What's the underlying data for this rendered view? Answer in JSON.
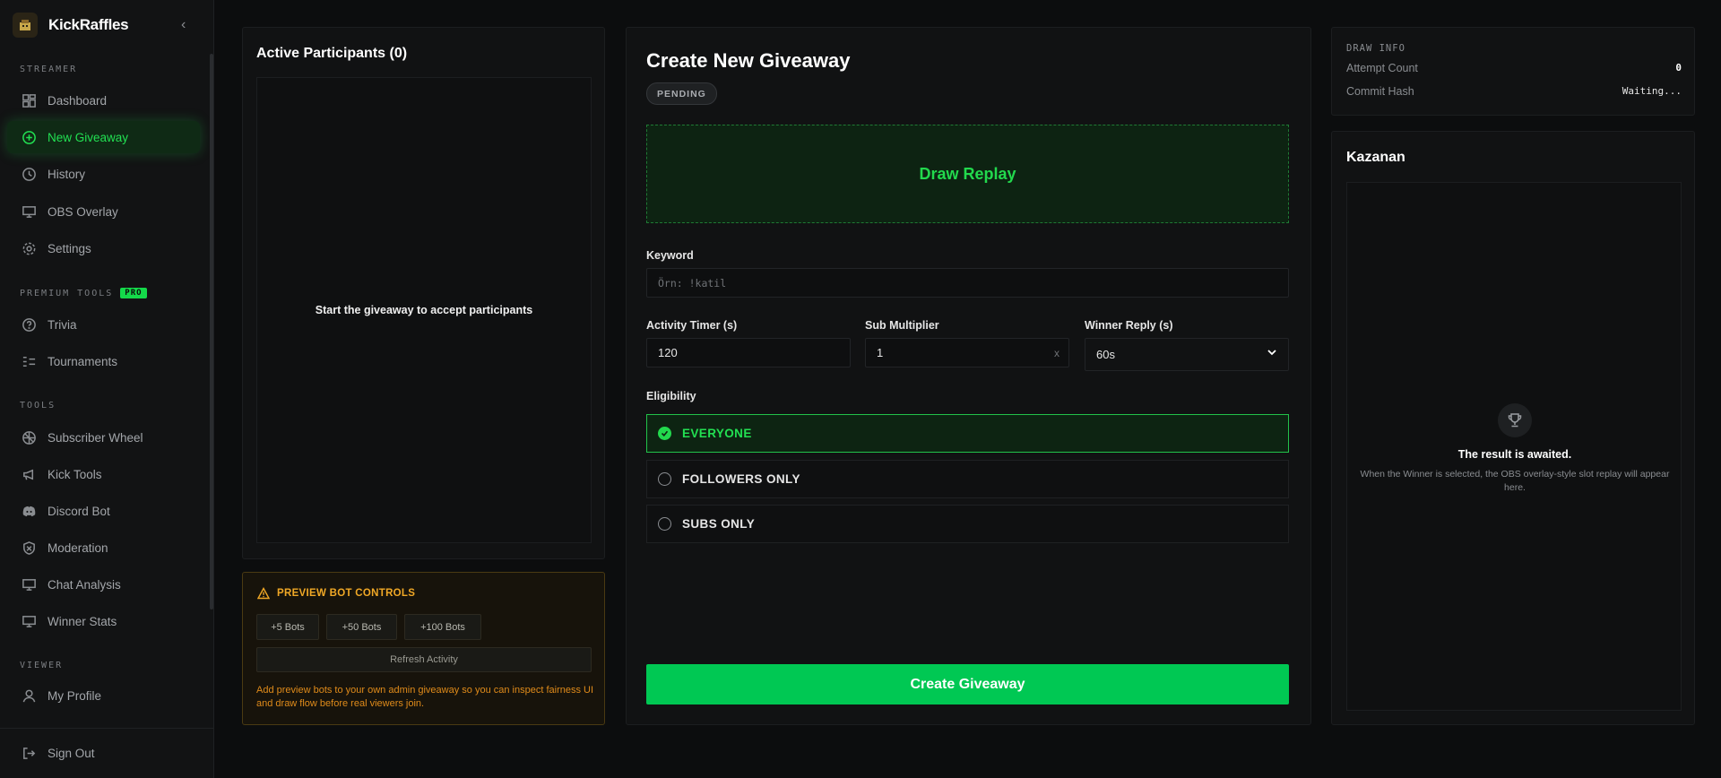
{
  "app": {
    "name": "KickRaffles"
  },
  "sidebar": {
    "sections": {
      "streamer": "STREAMER",
      "premium": "PREMIUM TOOLS",
      "pro_badge": "PRO",
      "tools": "TOOLS",
      "viewer": "VIEWER"
    },
    "streamer_items": [
      {
        "label": "Dashboard",
        "icon": "dashboard-icon"
      },
      {
        "label": "New Giveaway",
        "icon": "plus-circle-icon",
        "active": true
      },
      {
        "label": "History",
        "icon": "clock-icon"
      },
      {
        "label": "OBS Overlay",
        "icon": "monitor-icon"
      },
      {
        "label": "Settings",
        "icon": "gear-icon"
      }
    ],
    "premium_items": [
      {
        "label": "Trivia",
        "icon": "question-circle-icon"
      },
      {
        "label": "Tournaments",
        "icon": "bracket-icon"
      }
    ],
    "tools_items": [
      {
        "label": "Subscriber Wheel",
        "icon": "wheel-icon"
      },
      {
        "label": "Kick Tools",
        "icon": "megaphone-icon"
      },
      {
        "label": "Discord Bot",
        "icon": "discord-icon"
      },
      {
        "label": "Moderation",
        "icon": "shield-icon"
      },
      {
        "label": "Chat Analysis",
        "icon": "monitor-icon"
      },
      {
        "label": "Winner Stats",
        "icon": "monitor-icon"
      }
    ],
    "viewer_items": [
      {
        "label": "My Profile",
        "icon": "user-icon"
      }
    ],
    "sign_out": "Sign Out"
  },
  "participants": {
    "title": "Active Participants (0)",
    "empty": "Start the giveaway to accept participants"
  },
  "bot_controls": {
    "title": "PREVIEW BOT CONTROLS",
    "buttons": [
      "+5 Bots",
      "+50 Bots",
      "+100 Bots"
    ],
    "refresh": "Refresh Activity",
    "note": "Add preview bots to your own admin giveaway so you can inspect fairness UI and draw flow before real viewers join."
  },
  "create": {
    "title": "Create New Giveaway",
    "status": "PENDING",
    "draw_replay": "Draw Replay",
    "keyword_label": "Keyword",
    "keyword_placeholder": "Örn: !katil",
    "activity_label": "Activity Timer (s)",
    "activity_value": "120",
    "sub_label": "Sub Multiplier",
    "sub_value": "1",
    "sub_suffix": "x",
    "reply_label": "Winner Reply (s)",
    "reply_value": "60s",
    "eligibility_label": "Eligibility",
    "options": [
      "EVERYONE",
      "FOLLOWERS ONLY",
      "SUBS ONLY"
    ],
    "selected_option": "EVERYONE",
    "submit": "Create Giveaway"
  },
  "draw_info": {
    "caption": "DRAW INFO",
    "attempt_label": "Attempt Count",
    "attempt_value": "0",
    "hash_label": "Commit Hash",
    "hash_value": "Waiting..."
  },
  "winner": {
    "title": "Kazanan",
    "result_title": "The result is awaited.",
    "result_desc": "When the Winner is selected, the OBS overlay-style slot replay will appear here."
  },
  "colors": {
    "accent": "#22e052",
    "button": "#00c853",
    "warning": "#f0a826",
    "background": "#0c0d0e"
  }
}
